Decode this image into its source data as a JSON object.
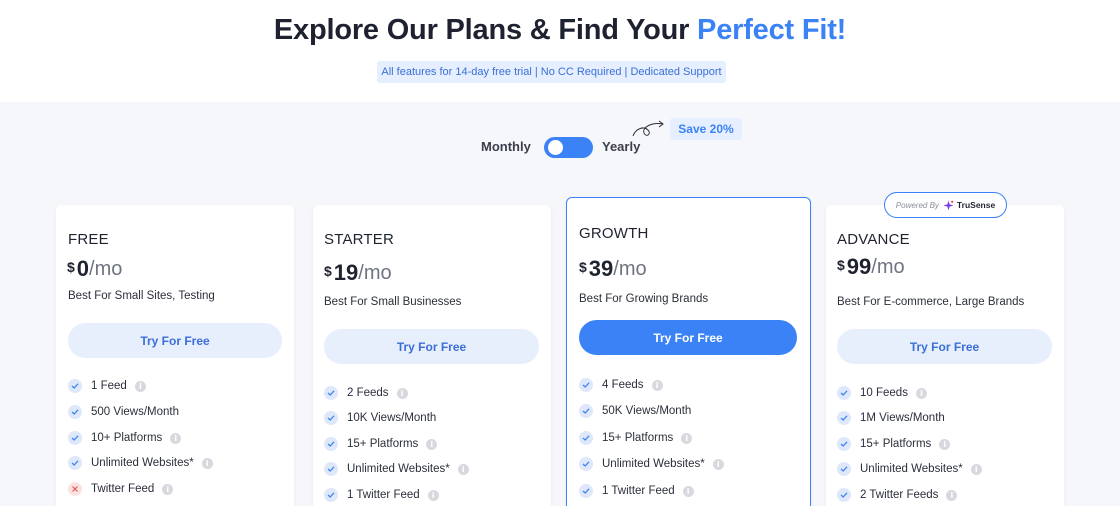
{
  "header": {
    "title_pre": "Explore Our Plans & Find Your ",
    "title_accent": "Perfect Fit!",
    "features_note": "All features for 14-day free trial | No CC Required | Dedicated Support"
  },
  "billing": {
    "monthly_label": "Monthly",
    "yearly_label": "Yearly",
    "save_badge": "Save 20%",
    "selected": "Yearly"
  },
  "powered_by": {
    "prefix": "Powered By",
    "brand": "TruSense"
  },
  "plans": [
    {
      "name": "FREE",
      "currency": "$",
      "amount": "0",
      "period": "/mo",
      "best_for": "Best For Small Sites, Testing",
      "cta": "Try For Free",
      "features": [
        {
          "text": "1 Feed",
          "included": true
        },
        {
          "text": "500 Views/Month",
          "included": true
        },
        {
          "text": "10+ Platforms",
          "included": true
        },
        {
          "text": "Unlimited Websites*",
          "included": true
        },
        {
          "text": "Twitter Feed",
          "included": false
        }
      ]
    },
    {
      "name": "STARTER",
      "currency": "$",
      "amount": "19",
      "period": "/mo",
      "best_for": "Best For Small Businesses",
      "cta": "Try For Free",
      "features": [
        {
          "text": "2 Feeds",
          "included": true
        },
        {
          "text": "10K Views/Month",
          "included": true
        },
        {
          "text": "15+ Platforms",
          "included": true
        },
        {
          "text": "Unlimited Websites*",
          "included": true
        },
        {
          "text": "1 Twitter Feed",
          "included": true
        }
      ]
    },
    {
      "name": "GROWTH",
      "currency": "$",
      "amount": "39",
      "period": "/mo",
      "best_for": "Best For Growing Brands",
      "cta": "Try For Free",
      "features": [
        {
          "text": "4 Feeds",
          "included": true
        },
        {
          "text": "50K Views/Month",
          "included": true
        },
        {
          "text": "15+ Platforms",
          "included": true
        },
        {
          "text": "Unlimited Websites*",
          "included": true
        },
        {
          "text": "1 Twitter Feed",
          "included": true
        }
      ]
    },
    {
      "name": "ADVANCE",
      "currency": "$",
      "amount": "99",
      "period": "/mo",
      "best_for": "Best For E-commerce, Large Brands",
      "cta": "Try For Free",
      "features": [
        {
          "text": "10 Feeds",
          "included": true
        },
        {
          "text": "1M Views/Month",
          "included": true
        },
        {
          "text": "15+ Platforms",
          "included": true
        },
        {
          "text": "Unlimited Websites*",
          "included": true
        },
        {
          "text": "2 Twitter Feeds",
          "included": true
        }
      ]
    }
  ],
  "colors": {
    "accent": "#3b82f6",
    "heading": "#1e2230",
    "pill_bg": "#e6efff",
    "page_bg": "#f6f7fb",
    "excluded": "#e05656"
  }
}
